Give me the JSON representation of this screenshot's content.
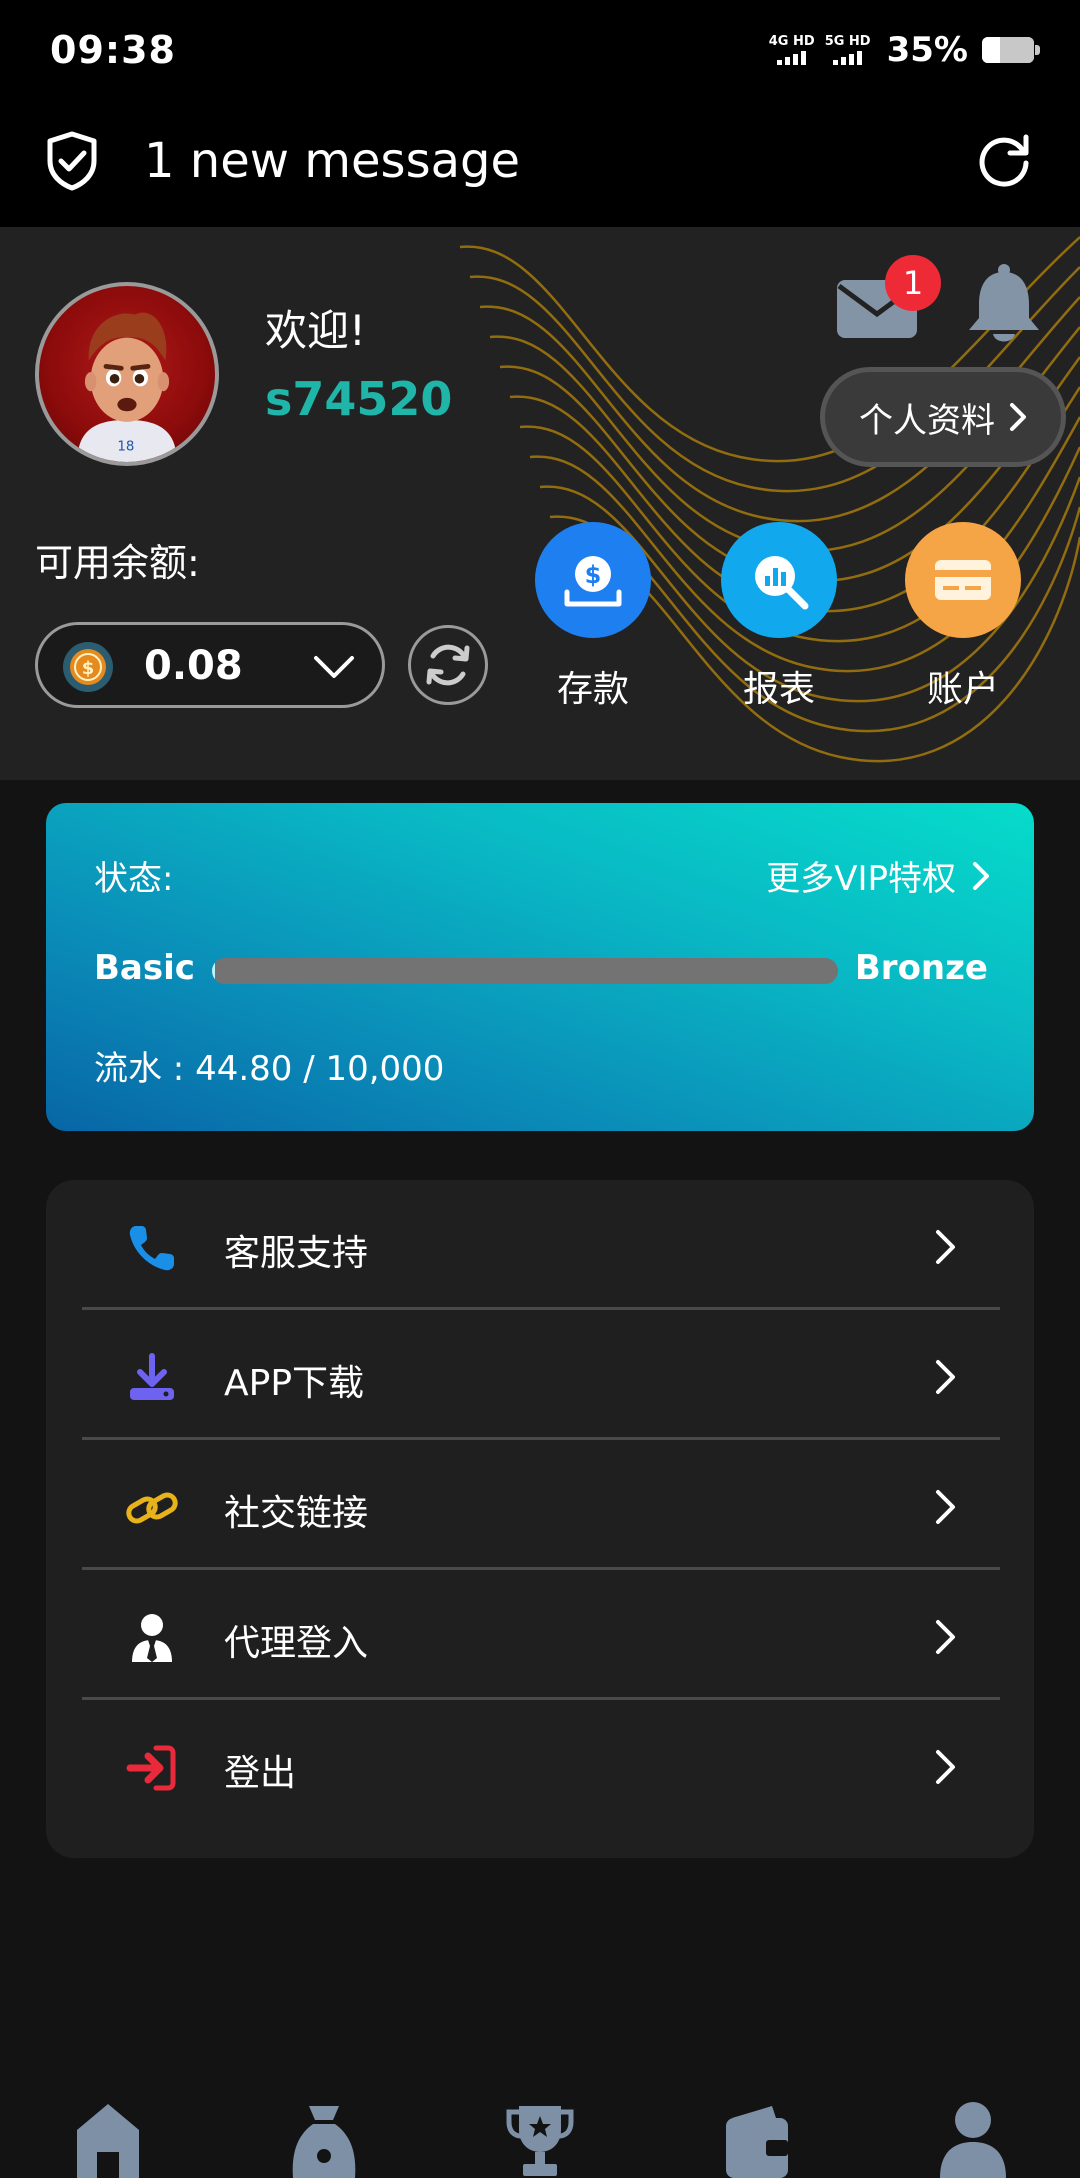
{
  "status_bar": {
    "time": "09:38",
    "net1": "4G HD",
    "net2": "5G HD",
    "battery": "35%",
    "battery_level_percent": 35
  },
  "notification": {
    "text": "1 new message",
    "icon": "shield-check-icon"
  },
  "profile": {
    "welcome": "欢迎!",
    "username": "s74520",
    "mail_badge": "1",
    "profile_button": "个人资料",
    "balance_label": "可用余额:",
    "balance_value": "0.08"
  },
  "quick_actions": [
    {
      "label": "存款",
      "icon": "deposit-icon",
      "color": "#1e7ff1"
    },
    {
      "label": "报表",
      "icon": "report-icon",
      "color": "#12a8ee"
    },
    {
      "label": "账户",
      "icon": "card-icon",
      "color": "#f5a546"
    }
  ],
  "vip": {
    "status_label": "状态:",
    "more_link": "更多VIP特权",
    "current_level": "Basic",
    "next_level": "Bronze",
    "turnover": "流水 : 44.80 / 10,000",
    "progress_fraction": 0.0045
  },
  "menu": [
    {
      "label": "客服支持",
      "icon": "phone-icon"
    },
    {
      "label": "APP下载",
      "icon": "download-icon"
    },
    {
      "label": "社交链接",
      "icon": "link-icon"
    },
    {
      "label": "代理登入",
      "icon": "agent-icon"
    },
    {
      "label": "登出",
      "icon": "logout-icon"
    }
  ],
  "bottom_nav": [
    {
      "icon": "home-icon"
    },
    {
      "icon": "bag-icon"
    },
    {
      "icon": "trophy-icon"
    },
    {
      "icon": "wallet-icon"
    },
    {
      "icon": "user-icon"
    }
  ],
  "colors": {
    "accent_teal": "#1fb5a8",
    "badge_red": "#ef2a37"
  }
}
